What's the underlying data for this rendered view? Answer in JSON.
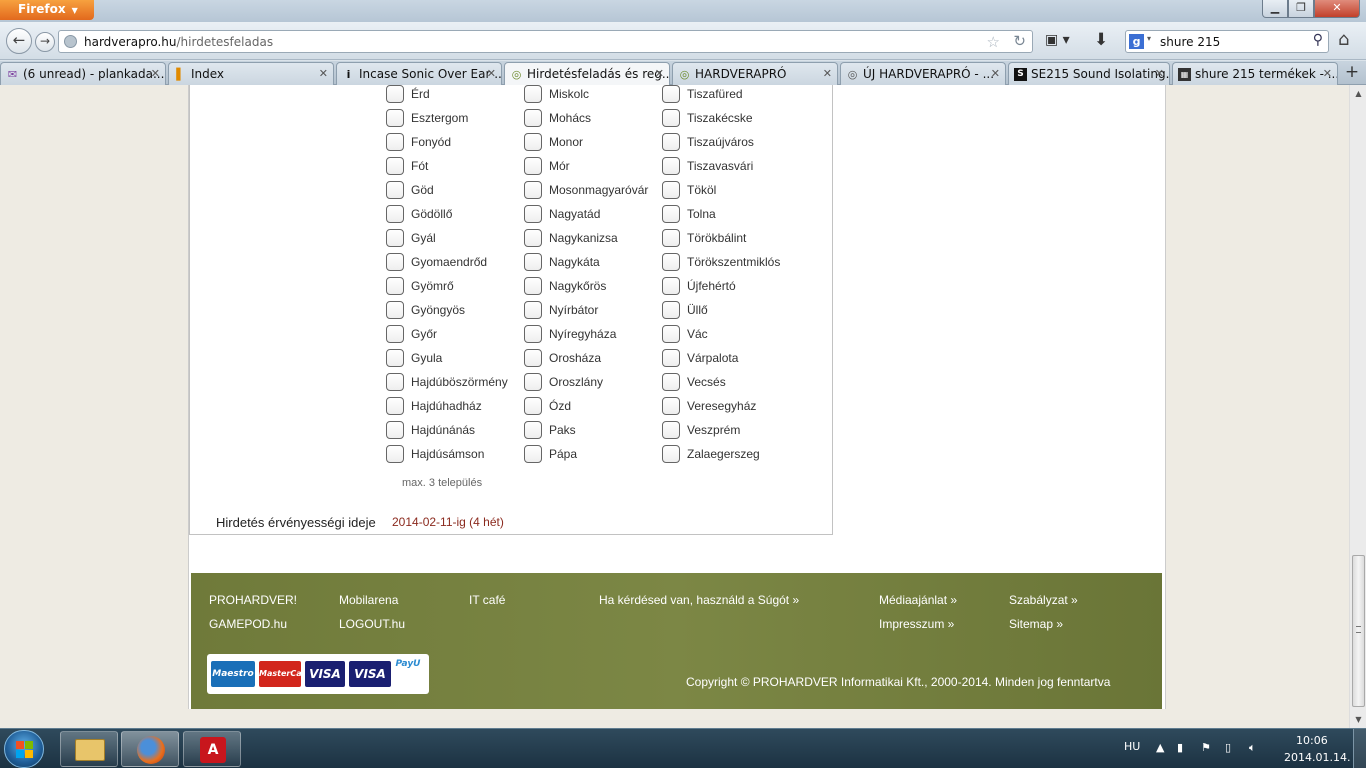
{
  "browser": {
    "menu_label": "Firefox",
    "url_host": "hardverapro.hu",
    "url_path": "/hirdetesfeladas",
    "search_query": "shure 215",
    "search_engine_glyph": "g",
    "tabs": [
      {
        "title": "(6 unread) - plankada...",
        "icon": "mail-icon"
      },
      {
        "title": "Index",
        "icon": "index-icon"
      },
      {
        "title": "Incase Sonic Over Ear ...",
        "icon": "info-icon"
      },
      {
        "title": "Hirdetésfeladás és reg...",
        "icon": "hardverapro-icon"
      },
      {
        "title": "HARDVERAPRÓ",
        "icon": "hardverapro-icon"
      },
      {
        "title": "ÚJ HARDVERAPRÓ - ...",
        "icon": "hardverapro-icon"
      },
      {
        "title": "SE215 Sound Isolating...",
        "icon": "shure-icon"
      },
      {
        "title": "shure 215 termékek - ...",
        "icon": "arukereso-icon"
      }
    ]
  },
  "form": {
    "cities": [
      [
        "Érd",
        "Esztergom",
        "Fonyód",
        "Fót",
        "Göd",
        "Gödöllő",
        "Gyál",
        "Gyomaendrőd",
        "Gyömrő",
        "Gyöngyös",
        "Győr",
        "Gyula",
        "Hajdúböszörmény",
        "Hajdúhadház",
        "Hajdúnánás",
        "Hajdúsámson"
      ],
      [
        "Miskolc",
        "Mohács",
        "Monor",
        "Mór",
        "Mosonmagyaróvár",
        "Nagyatád",
        "Nagykanizsa",
        "Nagykáta",
        "Nagykőrös",
        "Nyírbátor",
        "Nyíregyháza",
        "Orosháza",
        "Oroszlány",
        "Ózd",
        "Paks",
        "Pápa"
      ],
      [
        "Tiszafüred",
        "Tiszakécske",
        "Tiszaújváros",
        "Tiszavasvári",
        "Tököl",
        "Tolna",
        "Törökbálint",
        "Törökszentmiklós",
        "Újfehértó",
        "Üllő",
        "Vác",
        "Várpalota",
        "Vecsés",
        "Veresegyház",
        "Veszprém",
        "Zalaegerszeg"
      ]
    ],
    "max_note": "max. 3 település",
    "validity_label": "Hirdetés érvényességi ideje",
    "validity_value": "2014-02-11-ig (4 hét)"
  },
  "footer": {
    "links": {
      "prohardver": "PROHARDVER!",
      "gamepod": "GAMEPOD.hu",
      "mobilarena": "Mobilarena",
      "logout": "LOGOUT.hu",
      "itcafe": "IT café",
      "help": "Ha kérdésed van, használd a Súgót »",
      "media": "Médiaajánlat »",
      "impresszum": "Impresszum »",
      "rules": "Szabályzat »",
      "sitemap": "Sitemap »"
    },
    "payment_logos": [
      "Maestro",
      "MasterCard",
      "VISA",
      "VISA",
      "PayU"
    ],
    "copyright": "Copyright © PROHARDVER Informatikai Kft., 2000-2014. Minden jog fenntartva"
  },
  "taskbar": {
    "language": "HU",
    "time": "10:06",
    "date": "2014.01.14.",
    "acrobat_glyph": "A"
  },
  "colors": {
    "footer_bg": "#778241",
    "validity_text": "#8b2a1e",
    "firefox_button": "#e8771f"
  }
}
